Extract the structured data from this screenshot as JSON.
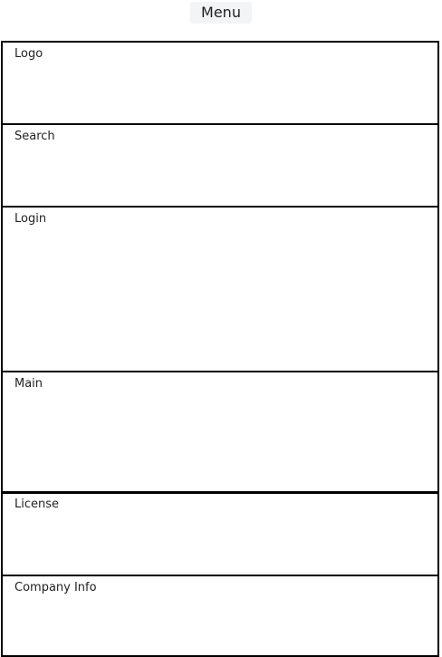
{
  "menu": {
    "label": "Menu"
  },
  "sections": {
    "logo": "Logo",
    "search": "Search",
    "login": "Login",
    "main": "Main",
    "license": "License",
    "company_info": "Company Info"
  }
}
